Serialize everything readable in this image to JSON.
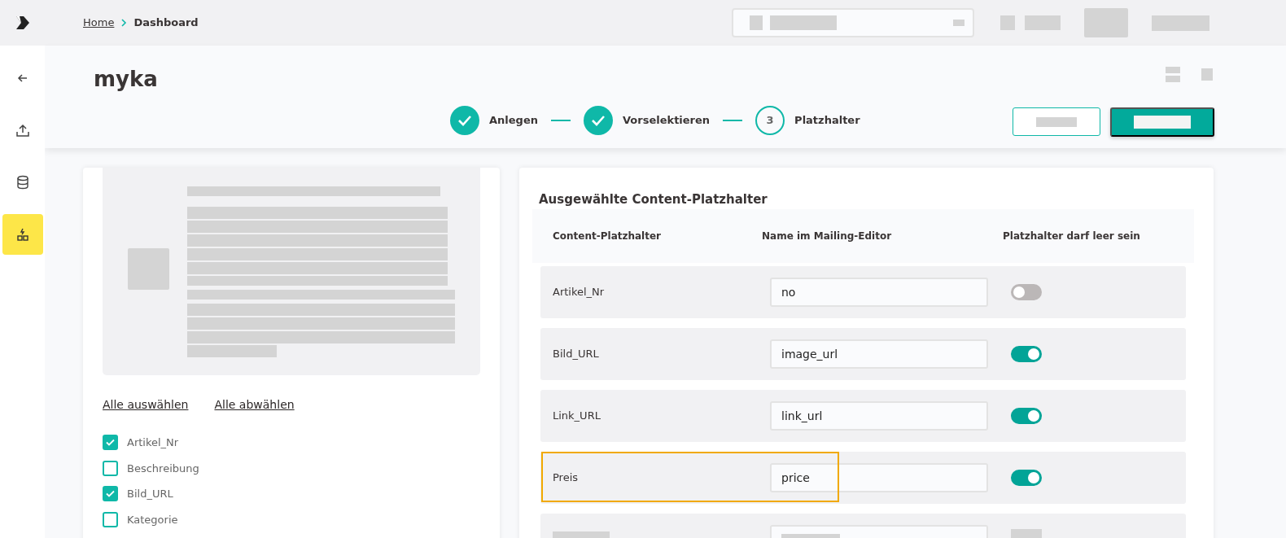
{
  "breadcrumb": [
    "Home",
    "Dashboard"
  ],
  "sidebar": {
    "items": [
      {
        "selected": false
      },
      {
        "selected": false
      },
      {
        "selected": false
      },
      {
        "selected": true
      }
    ]
  },
  "page_title": "myka",
  "stepper": [
    {
      "label": "Anlegen",
      "done": true
    },
    {
      "label": "Vorselektieren",
      "done": true
    },
    {
      "label": "Platzhalter",
      "done": false,
      "number": "3"
    }
  ],
  "select_links": [
    "Alle auswählen",
    "Alle abwählen"
  ],
  "fields": [
    {
      "label": "Artikel_Nr",
      "checked": true
    },
    {
      "label": "Beschreibung",
      "checked": false
    },
    {
      "label": "Bild_URL",
      "checked": true
    },
    {
      "label": "Kategorie",
      "checked": false
    }
  ],
  "placeholders": {
    "title": "Ausgewählte Content-Platzhalter",
    "columns": [
      "Content-Platzhalter",
      "Name im Mailing-Editor",
      "Platzhalter darf leer sein"
    ],
    "rows": [
      {
        "kind": "field",
        "placeholder": "Artikel_Nr",
        "name": "no",
        "may_be_empty": false,
        "highlighted": false
      },
      {
        "kind": "field",
        "placeholder": "Bild_URL",
        "name": "image_url",
        "may_be_empty": true,
        "highlighted": false
      },
      {
        "kind": "field",
        "placeholder": "Link_URL",
        "name": "link_url",
        "may_be_empty": true,
        "highlighted": false
      },
      {
        "kind": "field",
        "placeholder": "Preis",
        "name": "price",
        "may_be_empty": true,
        "highlighted": true
      },
      {
        "kind": "redacted"
      }
    ]
  }
}
